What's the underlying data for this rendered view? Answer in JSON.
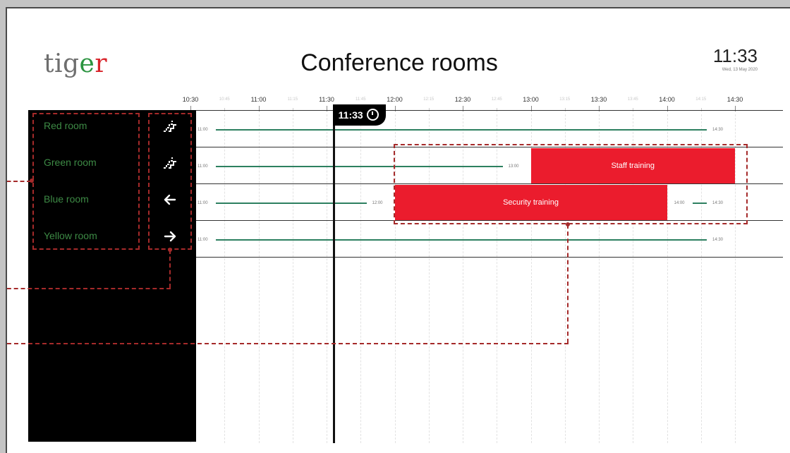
{
  "header": {
    "logo_letters": [
      "t",
      "i",
      "g",
      "e",
      "r"
    ],
    "logo_colors": [
      "#6e6e6e",
      "#6e6e6e",
      "#6e6e6e",
      "#2b9440",
      "#d8232a"
    ],
    "title": "Conference rooms",
    "clock_time": "11:33",
    "clock_date": "Wed, 13 May 2020"
  },
  "timeline": {
    "major_ticks": [
      "10:30",
      "11:00",
      "11:30",
      "12:00",
      "12:30",
      "13:00",
      "13:30",
      "14:00",
      "14:30"
    ],
    "minor_ticks": [
      "10:45",
      "11:15",
      "11:45",
      "12:15",
      "12:45",
      "13:15",
      "13:45",
      "14:15"
    ],
    "now_label": "11:33"
  },
  "rooms": [
    {
      "name": "Red room",
      "icon": "stairs-icon",
      "slots": [
        {
          "kind": "free",
          "start": "10:30",
          "end": "14:30",
          "start_label": "11:00",
          "end_label": "14:30"
        }
      ]
    },
    {
      "name": "Green room",
      "icon": "stairs-icon",
      "slots": [
        {
          "kind": "free",
          "start": "10:30",
          "end": "13:00",
          "start_label": "11:00",
          "end_label": "13:00"
        },
        {
          "kind": "event",
          "start": "13:00",
          "end": "14:30",
          "title": "Staff training"
        }
      ]
    },
    {
      "name": "Blue room",
      "icon": "arrow-left-icon",
      "slots": [
        {
          "kind": "free",
          "start": "10:30",
          "end": "12:00",
          "start_label": "11:00",
          "end_label": "12:00"
        },
        {
          "kind": "event",
          "start": "12:00",
          "end": "14:00",
          "title": "Security training"
        },
        {
          "kind": "free",
          "start": "14:00",
          "end": "14:30",
          "start_label": "14:00",
          "end_label": "14:30"
        }
      ]
    },
    {
      "name": "Yellow room",
      "icon": "arrow-right-icon",
      "slots": [
        {
          "kind": "free",
          "start": "10:30",
          "end": "14:30",
          "start_label": "11:00",
          "end_label": "14:30"
        }
      ]
    }
  ],
  "colors": {
    "event": "#eb1c2d",
    "room_text": "#3d8a45",
    "free_line": "#2d8060",
    "annotation": "#a52a2a"
  }
}
